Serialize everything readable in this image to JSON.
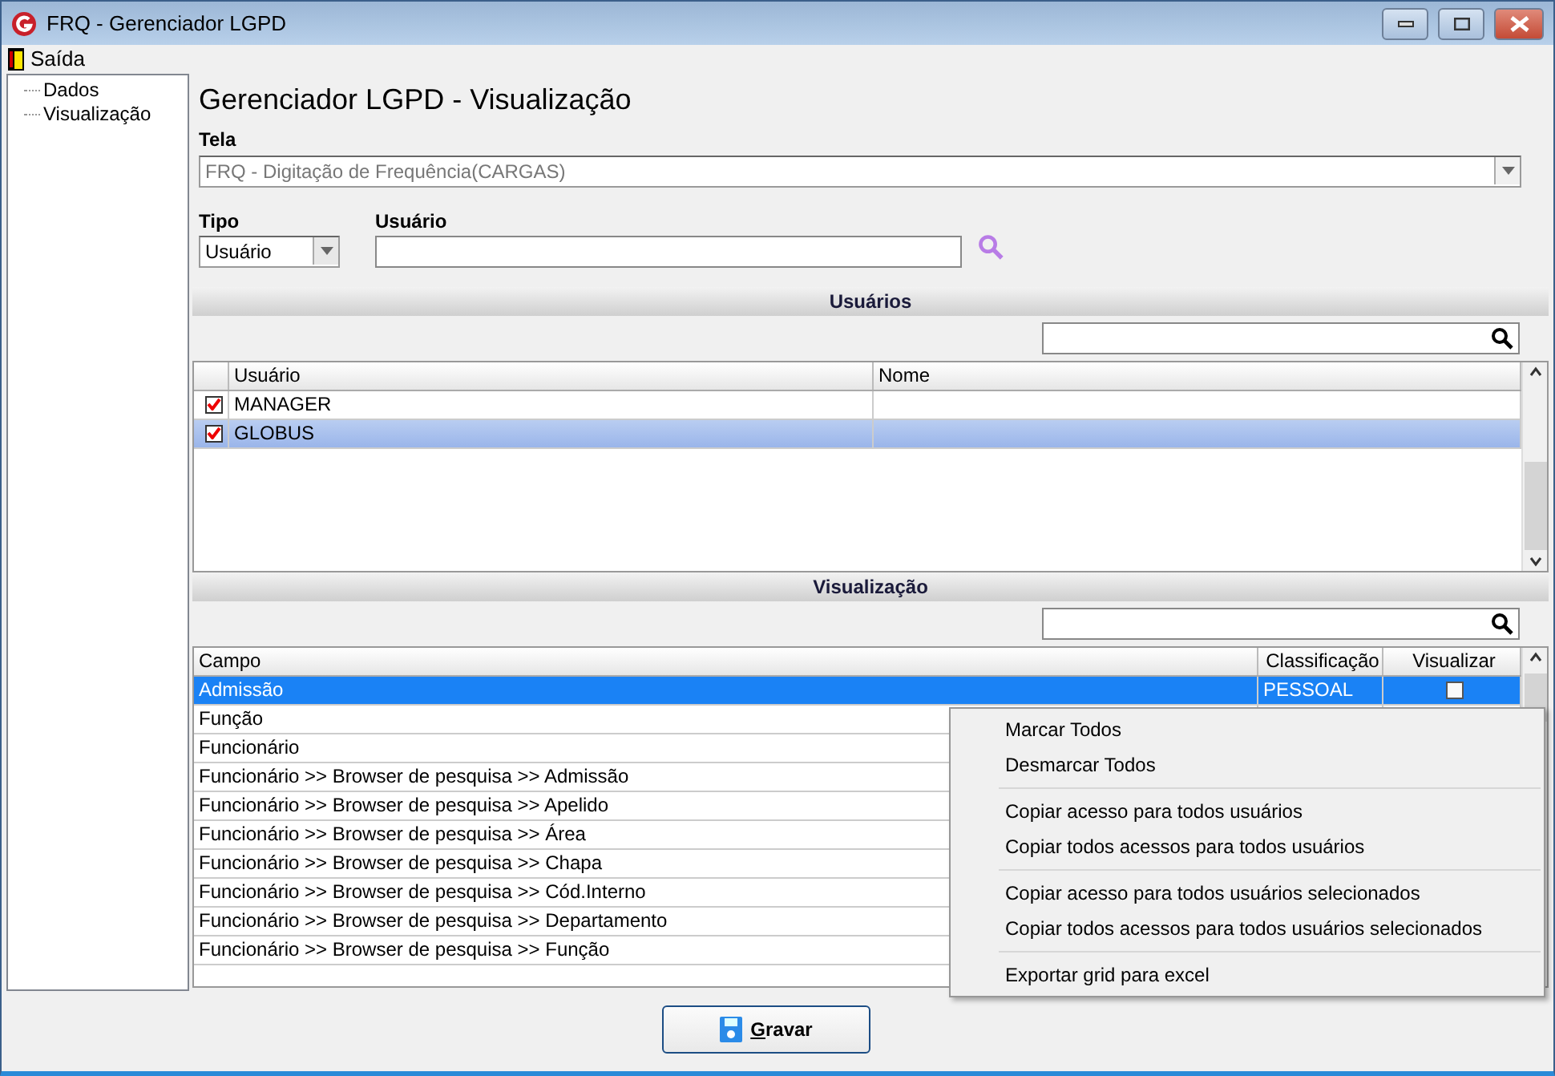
{
  "window": {
    "title": "FRQ - Gerenciador LGPD"
  },
  "menu": [
    {
      "label": "Saída"
    }
  ],
  "tree": [
    {
      "label": "Dados",
      "selected": false
    },
    {
      "label": "Visualização",
      "selected": false
    }
  ],
  "heading": "Gerenciador LGPD - Visualização",
  "tela": {
    "label": "Tela",
    "value": "FRQ - Digitação de Frequência(CARGAS)",
    "disabled": true
  },
  "tipo": {
    "label": "Tipo",
    "value": "Usuário"
  },
  "usuario": {
    "label": "Usuário"
  },
  "users_section": {
    "title": "Usuários",
    "columns": [
      "Usuário",
      "Nome"
    ],
    "rows": [
      {
        "checked": true,
        "selected": false,
        "usuario": "MANAGER"
      },
      {
        "checked": true,
        "selected": true,
        "usuario": "GLOBUS"
      }
    ]
  },
  "view_section": {
    "title": "Visualização",
    "columns": [
      "Campo",
      "Classificação",
      "Visualizar"
    ],
    "rows": [
      {
        "campo": "Admissão",
        "classificacao": "PESSOAL",
        "visualizar": false,
        "selected": true
      },
      {
        "campo": "Função",
        "selected": false
      },
      {
        "campo": "Funcionário",
        "selected": false
      },
      {
        "campo": "Funcionário >> Browser de pesquisa >> Admissão",
        "selected": false
      },
      {
        "campo": "Funcionário >> Browser de pesquisa >> Apelido",
        "selected": false
      },
      {
        "campo": "Funcionário >> Browser de pesquisa >> Área",
        "selected": false
      },
      {
        "campo": "Funcionário >> Browser de pesquisa >> Chapa",
        "selected": false
      },
      {
        "campo": "Funcionário >> Browser de pesquisa >> Cód.Interno",
        "selected": false
      },
      {
        "campo": "Funcionário >> Browser de pesquisa >> Departamento",
        "selected": false
      },
      {
        "campo": "Funcionário >> Browser de pesquisa >> Função",
        "selected": false
      }
    ]
  },
  "context_menu": [
    {
      "kind": "item",
      "label": "Marcar Todos"
    },
    {
      "kind": "item",
      "label": "Desmarcar Todos"
    },
    {
      "kind": "separator"
    },
    {
      "kind": "item",
      "label": "Copiar acesso para todos usuários"
    },
    {
      "kind": "item",
      "label": "Copiar todos acessos para todos usuários"
    },
    {
      "kind": "separator"
    },
    {
      "kind": "item",
      "label": "Copiar acesso para todos usuários selecionados"
    },
    {
      "kind": "item",
      "label": "Copiar todos acessos para todos usuários selecionados"
    },
    {
      "kind": "separator"
    },
    {
      "kind": "item",
      "label": "Exportar grid para excel"
    }
  ],
  "save_button": {
    "label": "Gravar"
  }
}
